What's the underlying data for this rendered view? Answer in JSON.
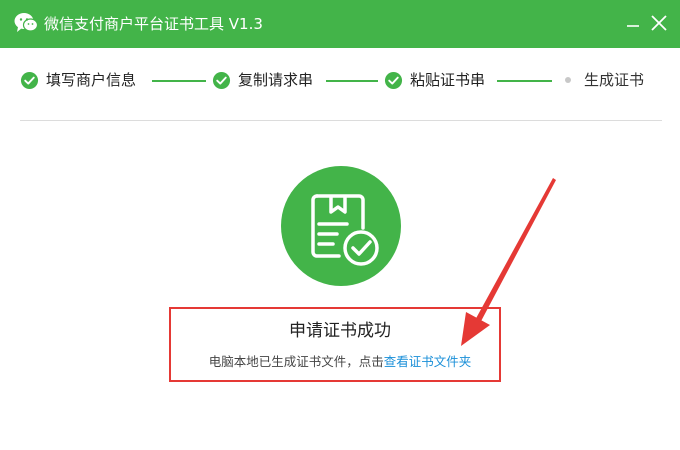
{
  "window": {
    "title": "微信支付商户平台证书工具 V1.3"
  },
  "steps": [
    {
      "label": "填写商户信息",
      "status": "done"
    },
    {
      "label": "复制请求串",
      "status": "done"
    },
    {
      "label": "粘贴证书串",
      "status": "done"
    },
    {
      "label": "生成证书",
      "status": "current"
    }
  ],
  "result": {
    "title": "申请证书成功",
    "desc_prefix": "电脑本地已生成证书文件，点击",
    "link_label": "查看证书文件夹"
  },
  "colors": {
    "brand_green": "#43b449",
    "link_blue": "#1a8fd8",
    "annotation_red": "#e53935"
  },
  "icons": {
    "app": "wechat-logo-icon",
    "minimize": "minimize-icon",
    "close": "close-icon",
    "step_done": "check-circle-icon",
    "step_pending": "dot-icon",
    "success": "certificate-check-icon"
  }
}
